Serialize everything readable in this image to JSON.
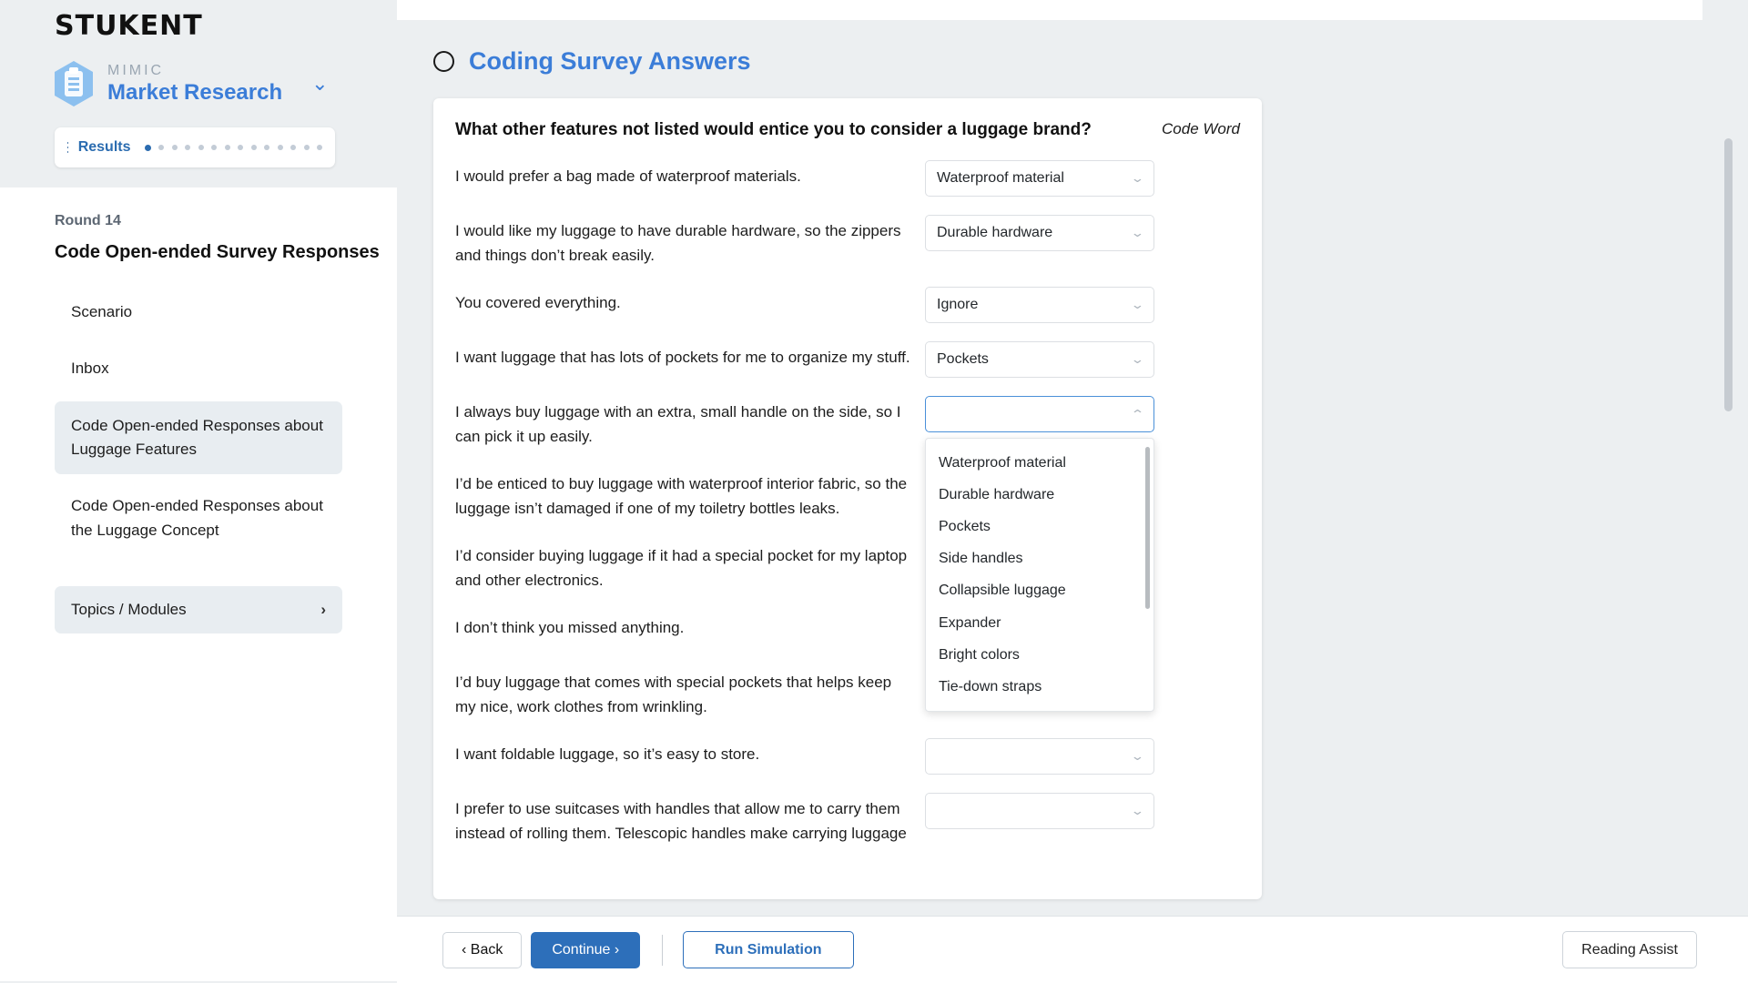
{
  "brand": {
    "logo": "STUKENT",
    "product_prefix": "MIMIC",
    "product_name": "Market Research",
    "chevron_icon": "chevron-down-icon"
  },
  "results_bar": {
    "label": "Results",
    "menu_icon": "hamburger-icon",
    "total_steps": 14,
    "active_step": 1
  },
  "sidebar": {
    "round_label": "Round 14",
    "round_title": "Code Open-ended Survey Responses",
    "items": [
      {
        "label": "Scenario",
        "active": false
      },
      {
        "label": "Inbox",
        "active": false
      },
      {
        "label": "Code Open-ended Responses about Luggage Features",
        "active": true
      },
      {
        "label": "Code Open-ended Responses about the Luggage Concept",
        "active": false
      }
    ],
    "topics": {
      "label": "Topics / Modules",
      "chevron_icon": "chevron-right-icon"
    }
  },
  "page": {
    "status_icon": "circle-outline-icon",
    "title": "Coding Survey Answers"
  },
  "card": {
    "question": "What other features not listed would entice you to consider a luggage brand?",
    "code_word_header": "Code Word",
    "placeholder": "",
    "rows": [
      {
        "text": "I would prefer a bag made of waterproof materials.",
        "value": "Waterproof material",
        "open": false
      },
      {
        "text": "I would like my luggage to have durable hardware, so the zippers and things don’t break easily.",
        "value": "Durable hardware",
        "open": false
      },
      {
        "text": "You covered everything.",
        "value": "Ignore",
        "open": false
      },
      {
        "text": "I want luggage that has lots of pockets for me to organize my stuff.",
        "value": "Pockets",
        "open": false
      },
      {
        "text": "I always buy luggage with an extra, small handle on the side, so I can pick it up easily.",
        "value": "",
        "open": true
      },
      {
        "text": "I’d be enticed to buy luggage with waterproof interior fabric, so the luggage isn’t damaged if one of my toiletry bottles leaks.",
        "value": "",
        "open": false
      },
      {
        "text": "I’d consider buying luggage if it had a special pocket for my laptop and other electronics.",
        "value": "",
        "open": false
      },
      {
        "text": "I don’t think you missed anything.",
        "value": "",
        "open": false
      },
      {
        "text": "I’d buy luggage that comes with special pockets that helps keep my nice, work clothes from wrinkling.",
        "value": "",
        "open": false
      },
      {
        "text": "I want foldable luggage, so it’s easy to store.",
        "value": "",
        "open": false
      },
      {
        "text": "I prefer to use suitcases with handles that allow me to carry them instead of rolling them. Telescopic handles make carrying luggage",
        "value": "",
        "open": false
      }
    ],
    "dropdown_options": [
      "Waterproof material",
      "Durable hardware",
      "Pockets",
      "Side handles",
      "Collapsible luggage",
      "Expander",
      "Bright colors",
      "Tie-down straps"
    ]
  },
  "footer": {
    "back": "‹ Back",
    "continue": "Continue ›",
    "run_simulation": "Run Simulation",
    "reading_assist": "Reading Assist"
  },
  "colors": {
    "accent_blue": "#2d6fba",
    "title_blue": "#3b7dd8",
    "sidebar_bg": "#eceff1",
    "active_nav": "#e8edf1"
  }
}
